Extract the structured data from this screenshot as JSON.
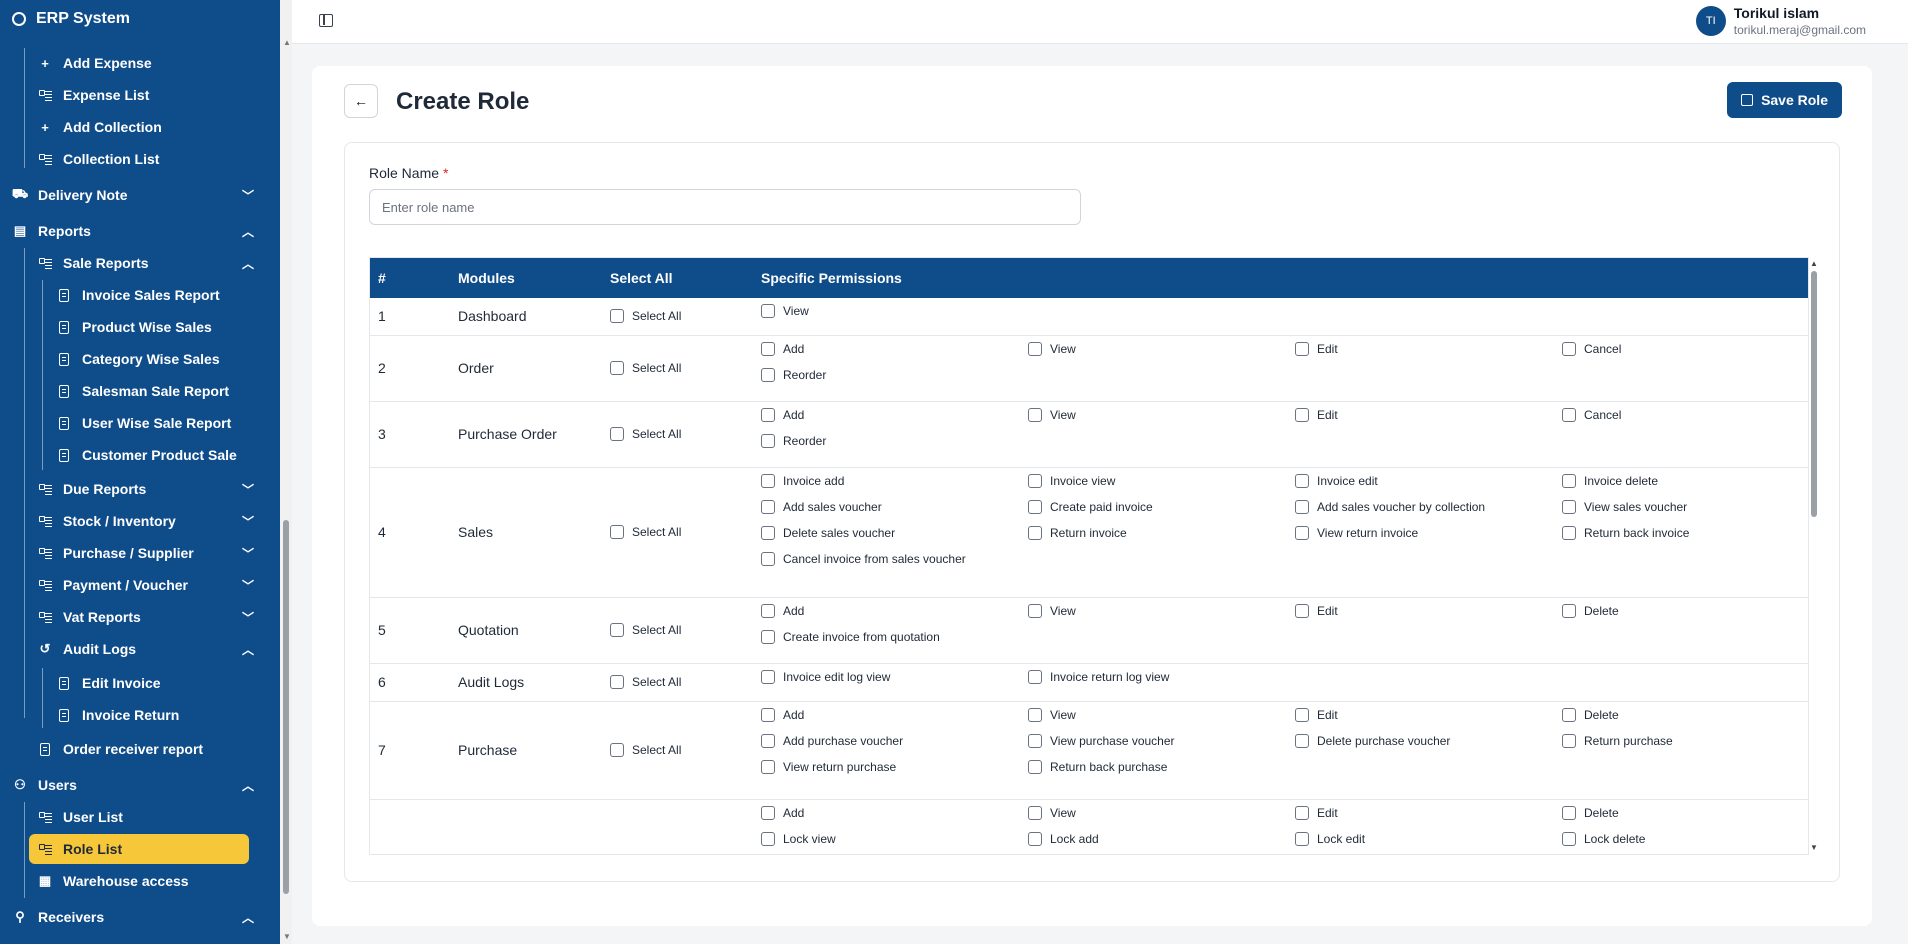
{
  "app": {
    "title": "ERP System"
  },
  "sidebar": {
    "items": [
      {
        "label": "Add Expense",
        "icon": "plus-icon"
      },
      {
        "label": "Expense List",
        "icon": "list-icon"
      },
      {
        "label": "Add Collection",
        "icon": "plus-icon"
      },
      {
        "label": "Collection List",
        "icon": "list-icon"
      },
      {
        "label": "Delivery Note",
        "icon": "truck-icon"
      },
      {
        "label": "Reports",
        "icon": "chart-icon"
      },
      {
        "label": "Sale Reports",
        "icon": "list-icon"
      },
      {
        "label": "Invoice Sales Report",
        "icon": "document-icon"
      },
      {
        "label": "Product Wise Sales",
        "icon": "document-icon"
      },
      {
        "label": "Category Wise Sales",
        "icon": "document-icon"
      },
      {
        "label": "Salesman Sale Report",
        "icon": "document-icon"
      },
      {
        "label": "User Wise Sale Report",
        "icon": "document-icon"
      },
      {
        "label": "Customer Product Sale",
        "icon": "document-icon"
      },
      {
        "label": "Due Reports",
        "icon": "list-icon"
      },
      {
        "label": "Stock / Inventory",
        "icon": "list-icon"
      },
      {
        "label": "Purchase / Supplier",
        "icon": "list-icon"
      },
      {
        "label": "Payment / Voucher",
        "icon": "list-icon"
      },
      {
        "label": "Vat Reports",
        "icon": "list-icon"
      },
      {
        "label": "Audit Logs",
        "icon": "history-icon"
      },
      {
        "label": "Edit Invoice",
        "icon": "document-icon"
      },
      {
        "label": "Invoice Return",
        "icon": "document-icon"
      },
      {
        "label": "Order receiver report",
        "icon": "document-icon"
      },
      {
        "label": "Users",
        "icon": "users-icon"
      },
      {
        "label": "User List",
        "icon": "list-icon"
      },
      {
        "label": "Role List",
        "icon": "list-icon"
      },
      {
        "label": "Warehouse access",
        "icon": "warehouse-icon"
      },
      {
        "label": "Receivers",
        "icon": "user-icon"
      }
    ]
  },
  "user": {
    "initials": "TI",
    "name": "Torikul islam",
    "email": "torikul.meraj@gmail.com"
  },
  "page": {
    "title": "Create Role",
    "save_label": "Save Role",
    "role_name_label": "Role Name",
    "required_mark": "*",
    "role_name_placeholder": "Enter role name",
    "role_name_value": ""
  },
  "table": {
    "headers": {
      "num": "#",
      "modules": "Modules",
      "select_all": "Select All",
      "permissions": "Specific Permissions"
    },
    "select_all_label": "Select All",
    "rows": [
      {
        "num": "1",
        "module": "Dashboard",
        "permissions": [
          "View"
        ]
      },
      {
        "num": "2",
        "module": "Order",
        "permissions": [
          "Add",
          "View",
          "Edit",
          "Cancel",
          "Reorder"
        ]
      },
      {
        "num": "3",
        "module": "Purchase Order",
        "permissions": [
          "Add",
          "View",
          "Edit",
          "Cancel",
          "Reorder"
        ]
      },
      {
        "num": "4",
        "module": "Sales",
        "permissions": [
          "Invoice add",
          "Invoice view",
          "Invoice edit",
          "Invoice delete",
          "Add sales voucher",
          "Create paid invoice",
          "Add sales voucher by collection",
          "View sales voucher",
          "Delete sales voucher",
          "Return invoice",
          "View return invoice",
          "Return back invoice",
          "Cancel invoice from sales voucher"
        ]
      },
      {
        "num": "5",
        "module": "Quotation",
        "permissions": [
          "Add",
          "View",
          "Edit",
          "Delete",
          "Create invoice from quotation"
        ]
      },
      {
        "num": "6",
        "module": "Audit Logs",
        "permissions": [
          "Invoice edit log view",
          "Invoice return log view"
        ]
      },
      {
        "num": "7",
        "module": "Purchase",
        "permissions": [
          "Add",
          "View",
          "Edit",
          "Delete",
          "Add purchase voucher",
          "View purchase voucher",
          "Delete purchase voucher",
          "Return purchase",
          "View return purchase",
          "Return back purchase"
        ]
      },
      {
        "num": "",
        "module": "",
        "permissions": [
          "Add",
          "View",
          "Edit",
          "Delete",
          "Lock view",
          "Lock add",
          "Lock edit",
          "Lock delete"
        ]
      }
    ]
  },
  "colors": {
    "primary": "#0f4c8a",
    "active_nav": "#f7c73a",
    "required": "#dc2626"
  }
}
